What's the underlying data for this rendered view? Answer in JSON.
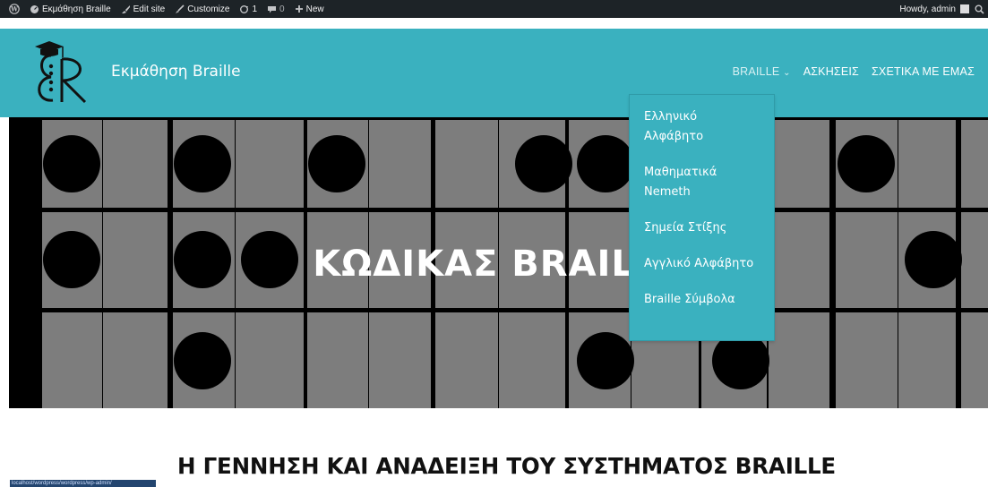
{
  "admin_bar": {
    "site_name": "Εκμάθηση Braille",
    "edit_site": "Edit site",
    "customize": "Customize",
    "updates_count": "1",
    "comments_count": "0",
    "new_label": "New",
    "greeting": "Howdy, admin"
  },
  "header": {
    "site_title": "Εκμάθηση Braille",
    "nav": [
      "BRAILLE",
      "ΑΣΚΗΣΕΙΣ",
      "ΣΧΕΤΙΚΑ ΜΕ ΕΜΑΣ"
    ],
    "dropdown": [
      "Ελληνικό Αλφάβητο",
      "Μαθηματικά Nemeth",
      "Σημεία Στίξης",
      "Αγγλικό Αλφάβητο",
      "Braille Σύμβολα"
    ]
  },
  "hero": {
    "title": "ΚΩΔΙΚΑΣ BRAILLE"
  },
  "content": {
    "thumb_text": "localhost/wordpress/wordpress/wp-admin/",
    "heading": "Η ΓΕΝΝΗΣΗ ΚΑΙ ΑΝΑΔΕΙΞΗ ΤΟΥ ΣΥΣΤΗΜΑΤΟΣ BRAILLE"
  },
  "colors": {
    "accent": "#3ab1bf",
    "admin_bar": "#1d2327",
    "cell": "#7d7d7d"
  }
}
